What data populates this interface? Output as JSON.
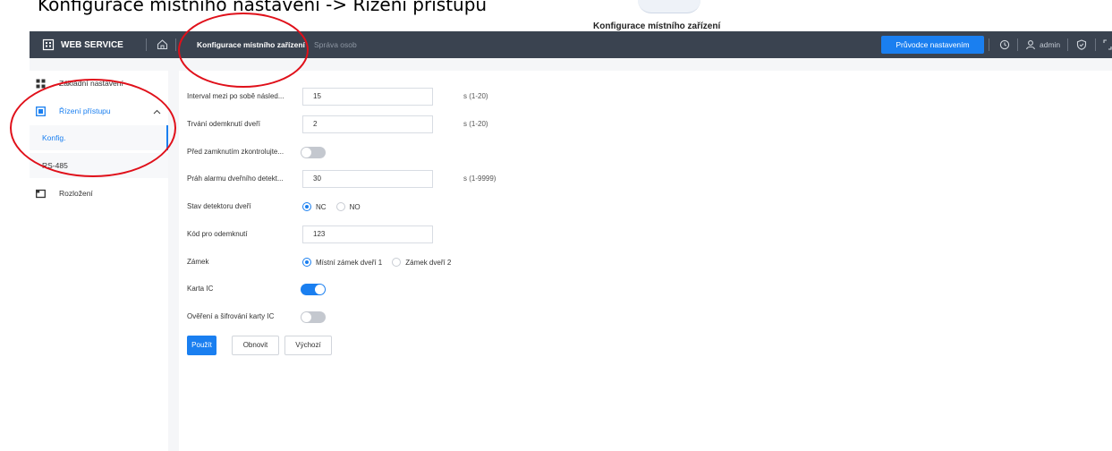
{
  "document": {
    "caption": "Konfigurace místního nastavení -> Řízení přístupu",
    "figure_caption": "Konfigurace místního zařízení"
  },
  "topbar": {
    "brand": "WEB SERVICE",
    "tabs": [
      {
        "label": "Konfigurace místního zařízení",
        "active": true
      },
      {
        "label": "Správa osob",
        "active": false
      }
    ],
    "wizard_label": "Průvodce nastavením",
    "user": "admin"
  },
  "sidebar": {
    "items": [
      {
        "label": "Základní nastavení"
      },
      {
        "label": "Řízení přístupu",
        "expanded": true,
        "children": [
          {
            "label": "Konfig.",
            "active": true
          },
          {
            "label": "RS-485",
            "active": false
          }
        ]
      },
      {
        "label": "Rozložení"
      }
    ]
  },
  "form": {
    "interval": {
      "label": "Interval mezi po sobě násled...",
      "value": "15",
      "unit": "s (1-20)"
    },
    "unlock_duration": {
      "label": "Trvání odemknutí dveří",
      "value": "2",
      "unit": "s (1-20)"
    },
    "check_before_lock": {
      "label": "Před zamknutím zkontrolujte...",
      "on": false
    },
    "alarm_threshold": {
      "label": "Práh alarmu dveřního detekt...",
      "value": "30",
      "unit": "s (1-9999)"
    },
    "door_sensor": {
      "label": "Stav detektoru dveří",
      "options": [
        "NC",
        "NO"
      ],
      "selected": "NC"
    },
    "unlock_code": {
      "label": "Kód pro odemknutí",
      "value": "123"
    },
    "lock": {
      "label": "Zámek",
      "options": [
        "Místní zámek dveří 1",
        "Zámek dveří 2"
      ],
      "selected": "Místní zámek dveří 1"
    },
    "ic_card": {
      "label": "Karta IC",
      "on": true
    },
    "ic_encryption": {
      "label": "Ověření a šifrování karty IC",
      "on": false
    }
  },
  "actions": {
    "apply": "Použít",
    "refresh": "Obnovit",
    "default": "Výchozí"
  },
  "colors": {
    "topbar": "#3a4350",
    "accent": "#1a7ff0",
    "annotation": "#e0101a"
  }
}
